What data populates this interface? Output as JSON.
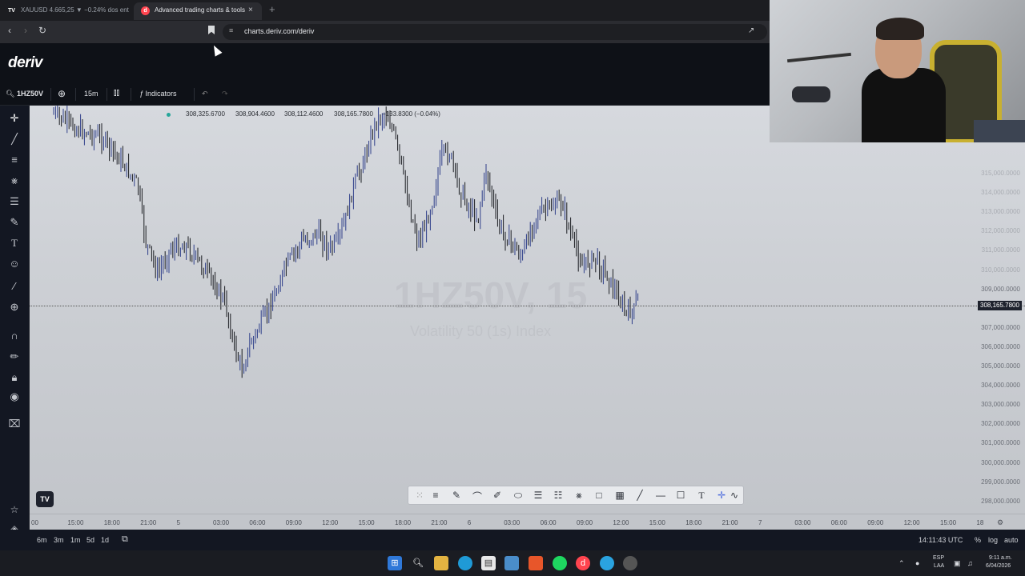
{
  "browser": {
    "tabs": [
      {
        "label": "XAUUSD 4.665,25 ▼ −0.24% dos ent",
        "favicon": "tradingview-icon"
      },
      {
        "label": "Advanced trading charts & tools",
        "favicon": "deriv-icon",
        "active": true
      }
    ],
    "close_glyph": "×",
    "newtab_glyph": "+",
    "url": "charts.deriv.com/deriv"
  },
  "app": {
    "logo": "deriv"
  },
  "toolbar": {
    "symbol": "1HZ50V",
    "interval": "15m",
    "indicators_label": "Indicators"
  },
  "chart": {
    "ohlc": [
      "308,325.6700",
      "308,904.4600",
      "308,112.4600",
      "308,165.7800",
      "−133.8300 (−0.04%)"
    ],
    "watermark_symbol": "1HZ50V, 15",
    "watermark_name": "Volatility 50 (1s) Index",
    "current_price": "308,165.7800",
    "y_ticks": [
      "315,000.0000",
      "314,000.0000",
      "313,000.0000",
      "312,000.0000",
      "311,000.0000",
      "310,000.0000",
      "309,000.0000",
      "307,000.0000",
      "306,000.0000",
      "305,000.0000",
      "304,000.0000",
      "303,000.0000",
      "302,000.0000",
      "301,000.0000",
      "300,000.0000",
      "299,000.0000",
      "298,000.0000"
    ],
    "x_ticks": [
      "00",
      "15:00",
      "18:00",
      "21:00",
      "5",
      "03:00",
      "06:00",
      "09:00",
      "12:00",
      "15:00",
      "18:00",
      "21:00",
      "6",
      "03:00",
      "06:00",
      "09:00",
      "12:00",
      "15:00",
      "18:00",
      "21:00",
      "7",
      "03:00",
      "06:00",
      "09:00",
      "12:00",
      "15:00",
      "18"
    ]
  },
  "bottom": {
    "ranges": [
      "6m",
      "3m",
      "1m",
      "5d",
      "1d"
    ],
    "time": "14:11:43 UTC",
    "pct": "%",
    "log": "log",
    "auto": "auto"
  },
  "taskbar": {
    "lang1": "ESP",
    "lang2": "LAA",
    "clock_time": "9:11 a.m.",
    "clock_date": "6/04/2026"
  },
  "colors": {
    "up_candle": "#2f3f8a",
    "down_candle": "#1b1d22",
    "chart_bg": "#d6d9de",
    "accent": "#ff444f"
  }
}
